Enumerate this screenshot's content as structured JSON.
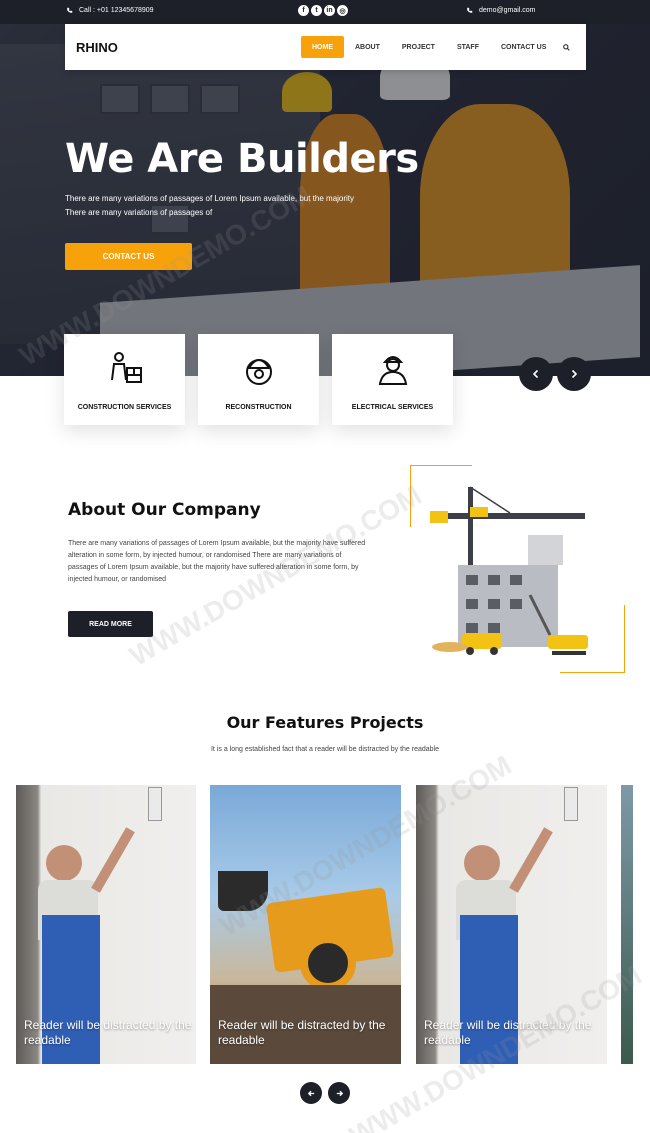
{
  "topbar": {
    "call": "Call : +01 12345678909",
    "email": "demo@gmail.com",
    "social": [
      "facebook",
      "twitter",
      "linkedin",
      "instagram"
    ]
  },
  "nav": {
    "logo": "RHINO",
    "items": [
      "HOME",
      "ABOUT",
      "PROJECT",
      "STAFF",
      "CONTACT US"
    ],
    "active": "HOME"
  },
  "hero": {
    "title": "We Are Builders",
    "line1": "There are many variations of passages of Lorem Ipsum available, but the majority",
    "line2": "There are many variations of passages of",
    "button": "CONTACT US"
  },
  "services": [
    {
      "label": "CONSTRUCTION SERVICES",
      "icon": "builder-icon"
    },
    {
      "label": "RECONSTRUCTION",
      "icon": "helmet-gear-icon"
    },
    {
      "label": "ELECTRICAL SERVICES",
      "icon": "worker-icon"
    }
  ],
  "about": {
    "title": "About Our Company",
    "text": "There are many variations of passages of Lorem Ipsum available, but the majority have suffered alteration in some form, by injected humour, or randomised There are many variations of passages of Lorem Ipsum available, but the majority have suffered alteration in some form, by injected humour, or randomised",
    "button": "READ MORE"
  },
  "features": {
    "title": "Our Features Projects",
    "subtitle": "It is a long established fact that a reader will be distracted by the readable",
    "projects": [
      {
        "caption": "Reader will be distracted by the readable"
      },
      {
        "caption": "Reader will be distracted by the readable"
      },
      {
        "caption": "Reader will be distracted by the readable"
      }
    ]
  },
  "watermark": "WWW.DOWNDEMO.COM",
  "colors": {
    "accent": "#f7a20b",
    "dark": "#1d1f29"
  }
}
